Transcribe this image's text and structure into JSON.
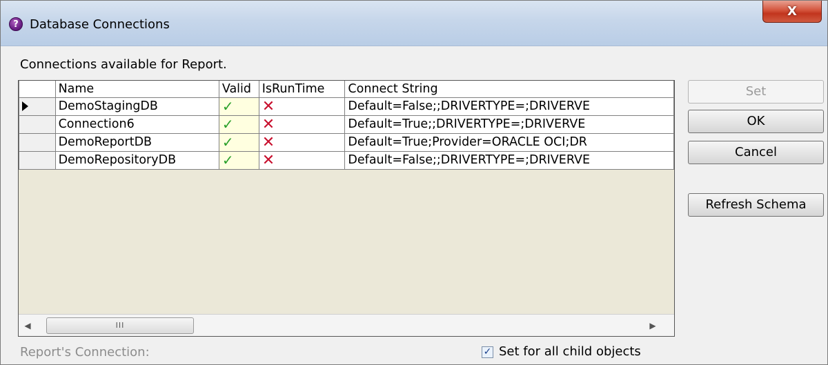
{
  "window": {
    "title": "Database Connections",
    "close_glyph": "X"
  },
  "caption": "Connections available for Report.",
  "grid": {
    "columns": [
      "Name",
      "Valid",
      "IsRunTime",
      "Connect String"
    ],
    "rows": [
      {
        "name": "DemoStagingDB",
        "valid": "✓",
        "runtime": "✕",
        "connect": "Default=False;;DRIVERTYPE=;DRIVERVE",
        "current": true
      },
      {
        "name": "Connection6",
        "valid": "✓",
        "runtime": "✕",
        "connect": "Default=True;;DRIVERTYPE=;DRIVERVE",
        "current": false
      },
      {
        "name": "DemoReportDB",
        "valid": "✓",
        "runtime": "✕",
        "connect": "Default=True;Provider=ORACLE OCI;DR",
        "current": false
      },
      {
        "name": "DemoRepositoryDB",
        "valid": "✓",
        "runtime": "✕",
        "connect": "Default=False;;DRIVERTYPE=;DRIVERVE",
        "current": false
      }
    ],
    "scroll_thumb_glyph": "III"
  },
  "buttons": {
    "set": "Set",
    "ok": "OK",
    "cancel": "Cancel",
    "refresh": "Refresh Schema"
  },
  "footer": {
    "report_connection_label": "Report's Connection:",
    "set_for_all_label": "Set for all child objects",
    "set_for_all_checked": true
  },
  "colors": {
    "valid_check": "#2aa02a",
    "runtime_cross": "#c8102e",
    "grid_background": "#ebe8d8"
  },
  "icons": {
    "app": "app-icon",
    "close": "close-icon",
    "row_selector": "row-selector-arrow-icon",
    "valid": "checkmark-icon",
    "runtime": "cross-icon"
  }
}
